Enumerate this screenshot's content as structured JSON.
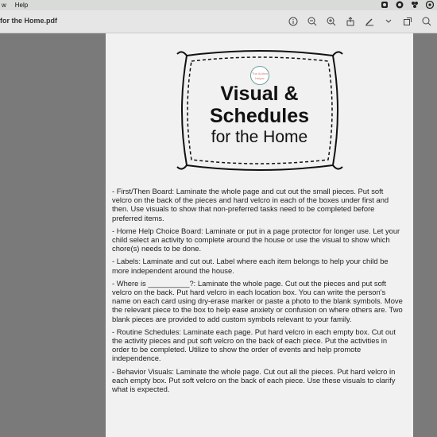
{
  "menubar": {
    "items": [
      "w",
      "Help"
    ]
  },
  "window": {
    "title": "for the Home.pdf"
  },
  "toolbar": {
    "icons": [
      "info-icon",
      "zoom-out-icon",
      "zoom-in-icon",
      "share-icon",
      "markup-pen-icon",
      "chevron-down-icon",
      "window-icon",
      "search-icon"
    ]
  },
  "document": {
    "logo_text": "The Autism Helper",
    "heading": {
      "line1": "Visual &",
      "line2": "Schedules",
      "line3": "for the Home"
    },
    "paragraphs": [
      "- First/Then Board: Laminate the whole page and cut out the small pieces. Put soft velcro on the back of the pieces and hard velcro in each of the boxes under first and then. Use visuals to show that non-preferred tasks need to be completed before preferred items.",
      "- Home Help Choice Board: Laminate or put in a page protector for longer use. Let your child select an activity to complete around the house or use the visual to show which chore(s) needs to be done.",
      "- Labels: Laminate and cut out. Label where each item belongs to help your child be more independent around the house.",
      "- Where is __________?: Laminate the whole page. Cut out the pieces and put soft velcro on the back. Put hard velcro in each location box. You can write the person's name on each card using dry-erase marker or paste a photo to the blank symbols. Move the relevant piece to the box to help ease anxiety or confusion on where others are. Two blank pieces are provided to add custom symbols relevant to your family.",
      "- Routine Schedules: Laminate each page. Put hard velcro in each empty box. Cut out the activity pieces and put soft velcro on the back of each piece. Put the activities in order to be completed. Utilize to show the order of events and help promote independence.",
      "- Behavior Visuals: Laminate the whole page. Cut out all the pieces. Put hard velcro in each empty box. Put soft velcro on the back of each piece. Use these visuals to clarify what is expected."
    ]
  }
}
